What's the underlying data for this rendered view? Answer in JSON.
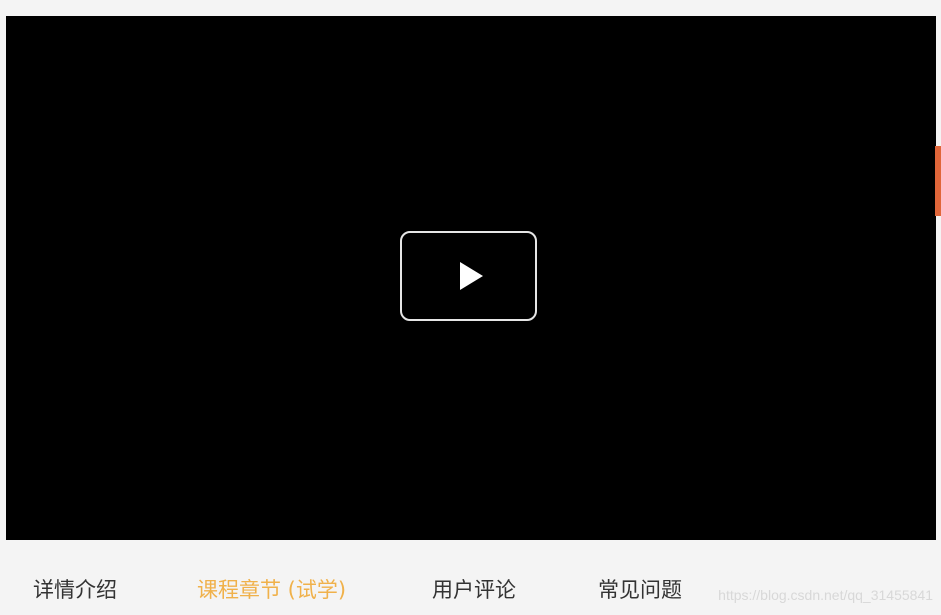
{
  "video": {
    "play_icon": "play-icon",
    "background_color": "#000000"
  },
  "colors": {
    "active_tab": "#f0b14a",
    "tab_text": "#333333",
    "side_marker": "#e0663a",
    "page_background": "#f4f4f4"
  },
  "tabs": [
    {
      "label": "详情介绍",
      "active": false
    },
    {
      "label": "课程章节 (试学)",
      "active": true
    },
    {
      "label": "用户评论",
      "active": false
    },
    {
      "label": "常见问题",
      "active": false
    }
  ],
  "watermark": "https://blog.csdn.net/qq_31455841"
}
